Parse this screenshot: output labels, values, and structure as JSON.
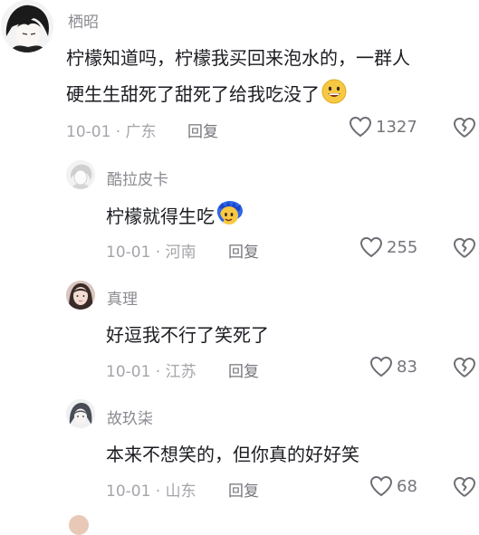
{
  "comments": [
    {
      "username": "栖昭",
      "text": "柠檬知道吗，柠檬我买回来泡水的，一群人",
      "text_line2": "硬生生甜死了甜死了给我吃没了",
      "emoji": "grinning-face-icon",
      "date": "10-01 · 广东",
      "reply_label": "回复",
      "likes": "1327"
    },
    {
      "username": "酷拉皮卡",
      "text": "柠檬就得生吃",
      "emoji": "blue-hair-face-icon",
      "date": "10-01 · 河南",
      "reply_label": "回复",
      "likes": "255"
    },
    {
      "username": "真理",
      "text": "好逗我不行了笑死了",
      "date": "10-01 · 江苏",
      "reply_label": "回复",
      "likes": "83"
    },
    {
      "username": "故玖柒",
      "text": "本来不想笑的，但你真的好好笑",
      "date": "10-01 · 山东",
      "reply_label": "回复",
      "likes": "68"
    }
  ],
  "colors": {
    "text": "#1b1c22",
    "muted": "#a4a5aa",
    "username": "#8a8b91"
  }
}
